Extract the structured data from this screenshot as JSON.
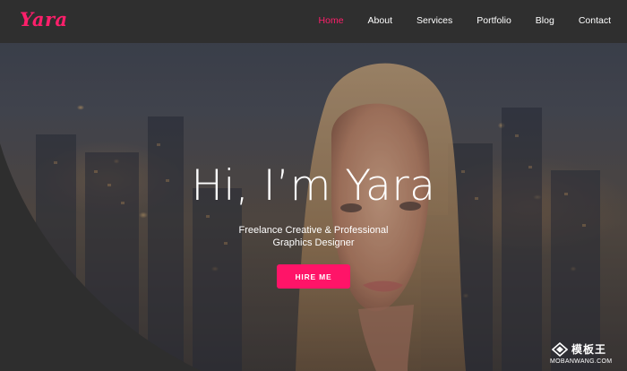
{
  "brand": {
    "logo_text": "Yara",
    "accent_color": "#ff1f6b"
  },
  "nav": {
    "items": [
      {
        "label": "Home",
        "active": true
      },
      {
        "label": "About",
        "active": false
      },
      {
        "label": "Services",
        "active": false
      },
      {
        "label": "Portfolio",
        "active": false
      },
      {
        "label": "Blog",
        "active": false
      },
      {
        "label": "Contact",
        "active": false
      }
    ]
  },
  "hero": {
    "title": "Hi, I’m Yara",
    "subtitle": "Freelance Creative & Professional Graphics Designer",
    "cta_label": "HIRE ME",
    "cta_color": "#ff1468"
  },
  "watermark": {
    "cn_text": "模板王",
    "en_text": "MOBANWANG.COM"
  }
}
